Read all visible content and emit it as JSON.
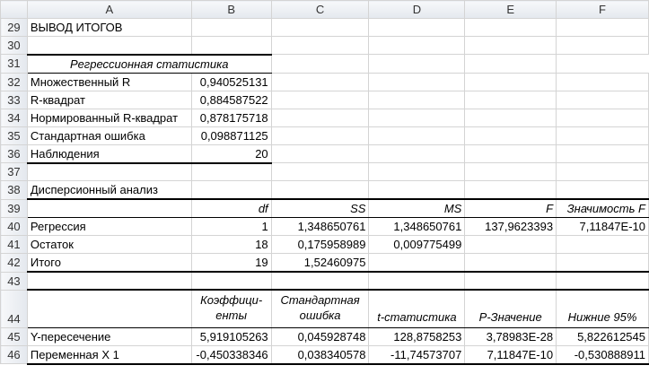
{
  "columns": [
    "A",
    "B",
    "C",
    "D",
    "E",
    "F"
  ],
  "rows": {
    "r29": {
      "num": "29",
      "a": "ВЫВОД ИТОГОВ"
    },
    "r30": {
      "num": "30"
    },
    "r31": {
      "num": "31",
      "a": "Регрессионная статистика"
    },
    "r32": {
      "num": "32",
      "a": "Множественный R",
      "b": "0,940525131"
    },
    "r33": {
      "num": "33",
      "a": "R-квадрат",
      "b": "0,884587522"
    },
    "r34": {
      "num": "34",
      "a": "Нормированный R-квадрат",
      "b": "0,878175718"
    },
    "r35": {
      "num": "35",
      "a": "Стандартная ошибка",
      "b": "0,098871125"
    },
    "r36": {
      "num": "36",
      "a": "Наблюдения",
      "b": "20"
    },
    "r37": {
      "num": "37"
    },
    "r38": {
      "num": "38",
      "a": "Дисперсионный анализ"
    },
    "r39": {
      "num": "39",
      "b": "df",
      "c": "SS",
      "d": "MS",
      "e": "F",
      "f": "Значимость F"
    },
    "r40": {
      "num": "40",
      "a": "Регрессия",
      "b": "1",
      "c": "1,348650761",
      "d": "1,348650761",
      "e": "137,9623393",
      "f": "7,11847E-10"
    },
    "r41": {
      "num": "41",
      "a": "Остаток",
      "b": "18",
      "c": "0,175958989",
      "d": "0,009775499"
    },
    "r42": {
      "num": "42",
      "a": "Итого",
      "b": "19",
      "c": "1,52460975"
    },
    "r43": {
      "num": "43"
    },
    "r44": {
      "num": "44",
      "b": "Коэффици-енты",
      "c": "Стандартная ошибка",
      "d": "t-статистика",
      "e": "P-Значение",
      "f": "Нижние 95%"
    },
    "r45": {
      "num": "45",
      "a": "Y-пересечение",
      "b": "5,919105263",
      "c": "0,045928748",
      "d": "128,8758253",
      "e": "3,78983E-28",
      "f": "5,822612545"
    },
    "r46": {
      "num": "46",
      "a": "Переменная X 1",
      "b": "-0,450338346",
      "c": "0,038340578",
      "d": "-11,74573707",
      "e": "7,11847E-10",
      "f": "-0,530888911"
    }
  }
}
